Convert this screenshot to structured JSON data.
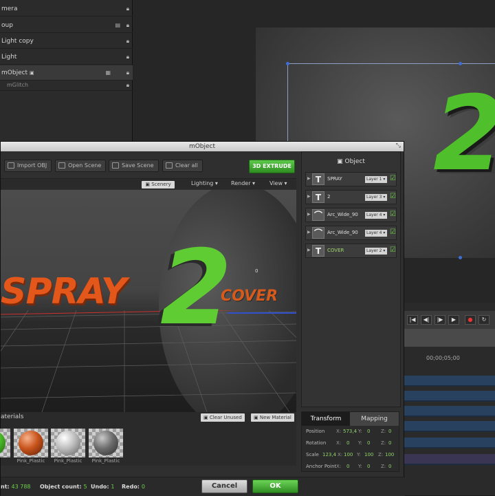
{
  "host": {
    "layers": [
      "mera",
      "oup",
      "Light copy",
      "Light",
      "mObject",
      "mGlitch"
    ],
    "timecode": "00;00;05;00"
  },
  "window": {
    "title": "mObject",
    "toolbar": {
      "import_obj": "Import OBJ",
      "open_scene": "Open Scene",
      "save_scene": "Save Scene",
      "clear_all": "Clear all",
      "extrude": "3D EXTRUDE"
    },
    "viewport_menu": {
      "scenery": "Scenery",
      "lighting": "Lighting",
      "render": "Render",
      "view": "View"
    },
    "scene_text": {
      "spray": "SPRAY",
      "two": "2",
      "cover": "COVER",
      "marker": "0"
    }
  },
  "materials": {
    "title": "aterials",
    "clear_unused": "Clear Unused",
    "new_material": "New Material",
    "swatches": [
      {
        "label": "astic",
        "color": "#4fbf2b"
      },
      {
        "label": "Pink_Plastic",
        "color": "#c8541c"
      },
      {
        "label": "Pink_Plastic",
        "color": "#bdbdbd"
      },
      {
        "label": "Pink_Plastic",
        "color": "#6d6d6d"
      }
    ]
  },
  "status": {
    "count_label_tail": "nt:",
    "count_value": "43 788",
    "object_count_label": "Object count:",
    "object_count_value": "5",
    "undo_label": "Undo:",
    "undo_value": "1",
    "redo_label": "Redo:",
    "redo_value": "0",
    "cancel": "Cancel",
    "ok": "OK"
  },
  "object_panel": {
    "title": "Object",
    "objects": [
      {
        "name": "SPRAY",
        "icon": "T",
        "layer": "Layer 1",
        "name_color": "#e0e0e0"
      },
      {
        "name": "2",
        "icon": "T",
        "layer": "Layer 3",
        "name_color": "#e0e0e0"
      },
      {
        "name": "Arc_Wide_90",
        "icon": "⌒",
        "layer": "Layer 4",
        "name_color": "#e0e0e0"
      },
      {
        "name": "Arc_Wide_90",
        "icon": "⌒",
        "layer": "Layer 4",
        "name_color": "#e0e0e0"
      },
      {
        "name": "COVER",
        "icon": "T",
        "layer": "Layer 2",
        "name_color": "#9fd96e"
      }
    ]
  },
  "transform": {
    "tabs": [
      "Transform",
      "Mapping"
    ],
    "rows": [
      {
        "label": "Position",
        "x": "573,4",
        "y": "0",
        "z": "0"
      },
      {
        "label": "Rotation",
        "x": "0",
        "y": "0",
        "z": "0"
      },
      {
        "label": "Scale",
        "x": "123,4",
        "y": "100",
        "z": "100",
        "x2": "100"
      },
      {
        "label": "Anchor Point",
        "x": "0",
        "y": "0",
        "z": "0"
      }
    ]
  }
}
